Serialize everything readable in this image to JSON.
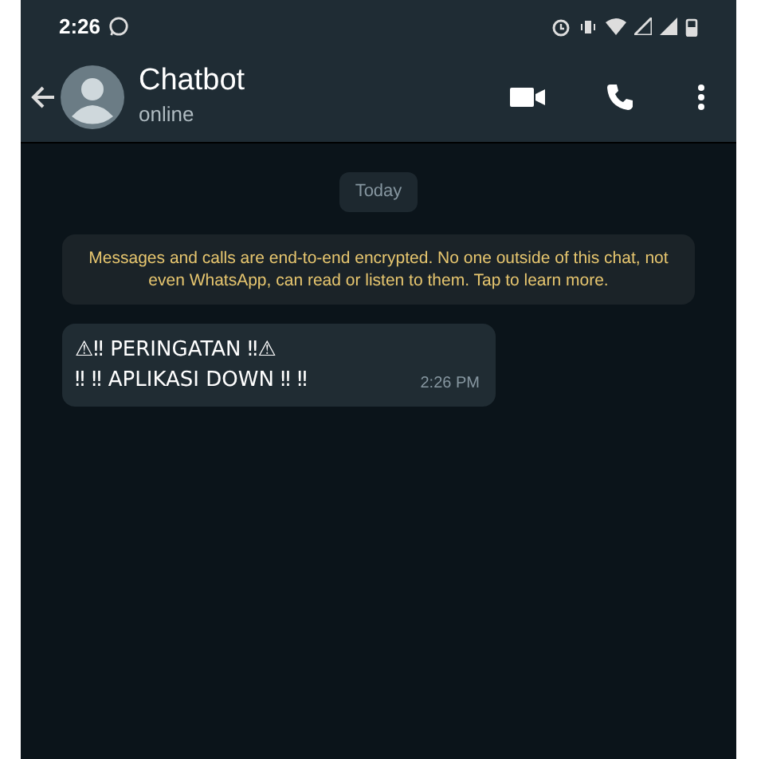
{
  "status_bar": {
    "time": "2:26"
  },
  "header": {
    "title": "Chatbot",
    "subtitle": "online"
  },
  "date_chip": "Today",
  "encryption_notice": "Messages and calls are end-to-end encrypted. No one outside of this chat, not even WhatsApp, can read or listen to them. Tap to learn more.",
  "messages": [
    {
      "lines": [
        "⚠‼ PERINGATAN ‼⚠",
        "‼ ‼ APLIKASI DOWN ‼ ‼"
      ],
      "time": "2:26 PM"
    }
  ]
}
